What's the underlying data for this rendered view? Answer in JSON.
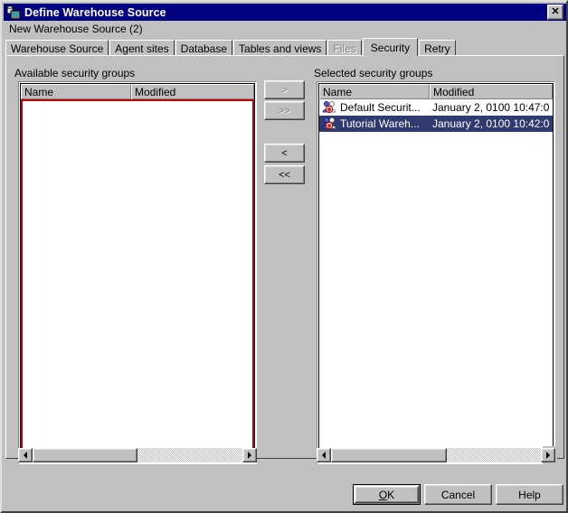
{
  "window": {
    "title": "Define Warehouse Source",
    "icon": "warehouse-database-icon",
    "close_label": "✕",
    "subtitle": "New Warehouse Source (2)"
  },
  "tabs": [
    {
      "label": "Warehouse Source",
      "state": "normal"
    },
    {
      "label": "Agent sites",
      "state": "normal"
    },
    {
      "label": "Database",
      "state": "normal"
    },
    {
      "label": "Tables and views",
      "state": "normal"
    },
    {
      "label": "Files",
      "state": "disabled"
    },
    {
      "label": "Security",
      "state": "active"
    },
    {
      "label": "Retry",
      "state": "normal"
    }
  ],
  "available_list": {
    "label": "Available security groups",
    "columns": [
      "Name",
      "Modified"
    ],
    "rows": [],
    "focus_border_color": "#c00000",
    "hscroll": {
      "left_arrow": "◀",
      "right_arrow": "▶"
    }
  },
  "selected_list": {
    "label": "Selected security groups",
    "columns": [
      "Name",
      "Modified"
    ],
    "rows": [
      {
        "icon": "security-group-icon",
        "name": "Default Securit...",
        "modified": "January 2, 0100 10:47:0",
        "selected": false
      },
      {
        "icon": "security-group-icon",
        "name": "Tutorial Wareh...",
        "modified": "January 2, 0100 10:42:0",
        "selected": true
      }
    ],
    "hscroll": {
      "left_arrow": "◀",
      "right_arrow": "▶"
    }
  },
  "transfer_buttons": [
    {
      "label": ">",
      "state": "disabled"
    },
    {
      "label": ">>",
      "state": "disabled"
    },
    {
      "label": "<",
      "state": "enabled"
    },
    {
      "label": "<<",
      "state": "enabled"
    }
  ],
  "dialog_buttons": {
    "ok": {
      "label": "OK",
      "accel": "O",
      "default": true
    },
    "cancel": {
      "label": "Cancel"
    },
    "help": {
      "label": "Help"
    }
  },
  "colors": {
    "titlebar": "#000080",
    "face": "#c0c0c0",
    "selection": "#2f3a6e",
    "focus_red": "#c00000"
  }
}
